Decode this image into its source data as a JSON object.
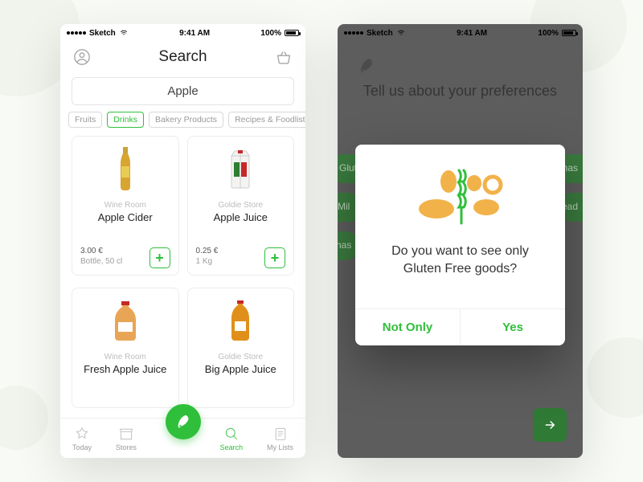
{
  "status": {
    "carrier": "Sketch",
    "time": "9:41 AM",
    "battery": "100%"
  },
  "left": {
    "title": "Search",
    "search_value": "Apple",
    "filters": [
      "Fruits",
      "Drinks",
      "Bakery Products",
      "Recipes & Foodlists"
    ],
    "filter_active_index": 1,
    "products": [
      {
        "store": "Wine Room",
        "name": "Apple Cider",
        "price": "3.00 €",
        "unit": "Bottle, 50 cl"
      },
      {
        "store": "Goldie Store",
        "name": "Apple Juice",
        "price": "0.25 €",
        "unit": "1 Kg"
      },
      {
        "store": "Wine Room",
        "name": "Fresh Apple Juice",
        "price": "",
        "unit": ""
      },
      {
        "store": "Goldie Store",
        "name": "Big Apple Juice",
        "price": "",
        "unit": ""
      }
    ],
    "tabs": [
      "Today",
      "Stores",
      "",
      "Search",
      "My Lists"
    ],
    "tab_active_index": 3
  },
  "right": {
    "prefs_heading": "Tell us about your preferences",
    "visible_tags_left": [
      "Glut",
      "Mil",
      "nas"
    ],
    "visible_tags_right": [
      "anas",
      "ead"
    ],
    "modal": {
      "question": "Do you want to see only Gluten Free goods?",
      "btn_no": "Not Only",
      "btn_yes": "Yes"
    }
  }
}
